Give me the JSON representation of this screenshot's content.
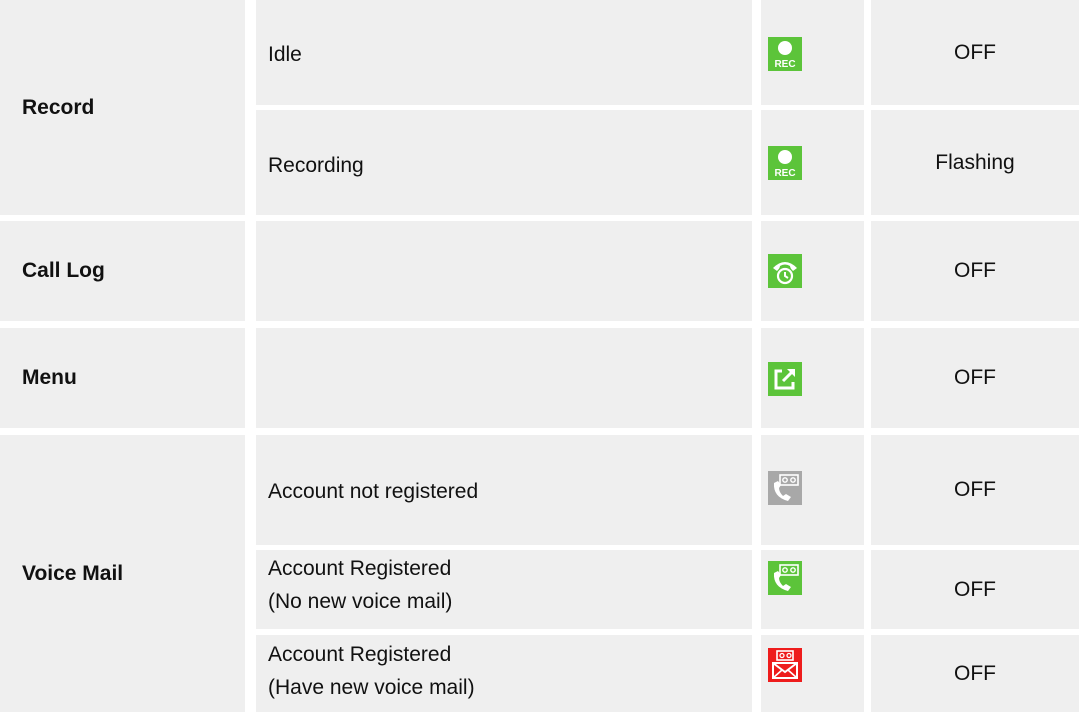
{
  "rows": [
    {
      "category": "Record",
      "condition": "Idle",
      "icon": "rec-icon",
      "led": "OFF"
    },
    {
      "category": "",
      "condition": "Recording",
      "icon": "rec-icon",
      "led": "Flashing"
    },
    {
      "category": "Call Log",
      "condition": "",
      "icon": "call-log-icon",
      "led": "OFF"
    },
    {
      "category": "Menu",
      "condition": "",
      "icon": "menu-icon",
      "led": "OFF"
    },
    {
      "category": "Voice Mail",
      "condition": "Account not registered",
      "icon": "voicemail-gray-icon",
      "led": "OFF"
    },
    {
      "category": "",
      "condition_line1": "Account Registered",
      "condition_line2": "(No new voice mail)",
      "icon": "voicemail-green-icon",
      "led": "OFF"
    },
    {
      "category": "",
      "condition_line1": "Account Registered",
      "condition_line2": "(Have new voice mail)",
      "icon": "voicemail-red-icon",
      "led": "OFF"
    }
  ],
  "colors": {
    "cell_bg": "#efefef",
    "icon_green": "#5cc43a",
    "icon_gray": "#a8a8a8",
    "icon_red": "#ee1c1c"
  }
}
